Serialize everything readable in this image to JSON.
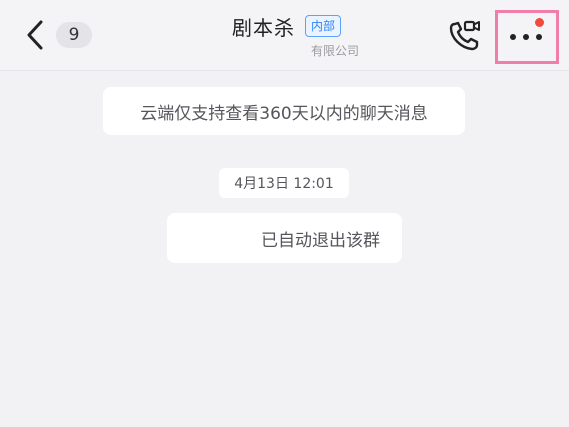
{
  "header": {
    "back_icon": "chevron-left-icon",
    "unread_count": "9",
    "title": "剧本杀",
    "tag": "内部",
    "subtitle": "有限公司",
    "call_icon": "video-call-icon",
    "more_icon": "more-dots-icon",
    "highlight_color": "#ef7fa8",
    "notification_color": "#f04a3a",
    "tag_color": "#2f86f6"
  },
  "messages": {
    "cloud_notice": "云端仅支持查看360天以内的聊天消息",
    "timestamp": "4月13日 12:01",
    "system_message": "已自动退出该群"
  }
}
